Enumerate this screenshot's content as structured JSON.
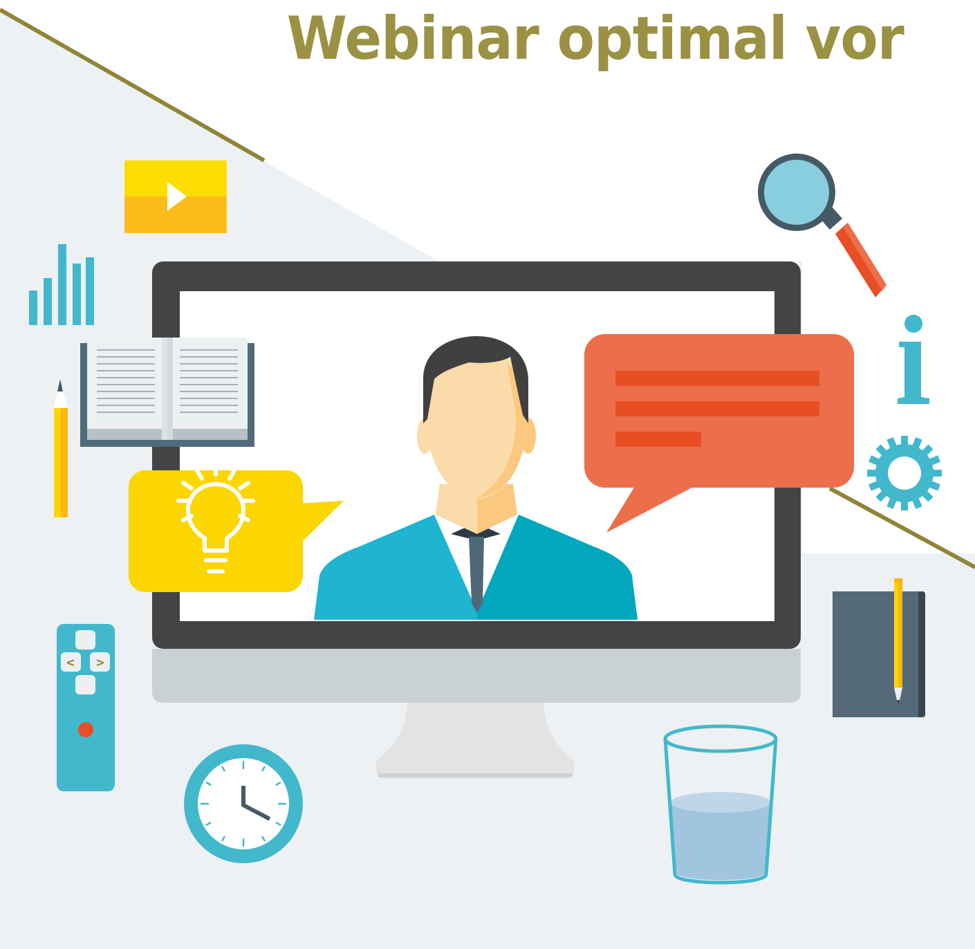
{
  "headline": "Webinar optimal vor",
  "remote": {
    "left_label": "<",
    "right_label": ">"
  },
  "colors": {
    "headline": "#9b9143",
    "diagonal_line": "#8e8537",
    "background_panel": "#edf1f4",
    "monitor_frame": "#444444",
    "monitor_chin": "#c9d1d4",
    "accent_teal": "#42b8cc",
    "speech_orange": "#ed6e4b",
    "speech_yellow": "#fbd600"
  },
  "icons": [
    "play-icon",
    "bar-chart-icon",
    "open-book-icon",
    "pencil-icon",
    "lightbulb-icon",
    "remote-control-icon",
    "clock-icon",
    "magnifier-icon",
    "info-icon",
    "gear-icon",
    "notebook-icon",
    "water-glass-icon",
    "presenter-avatar",
    "speech-bubble-icon"
  ]
}
